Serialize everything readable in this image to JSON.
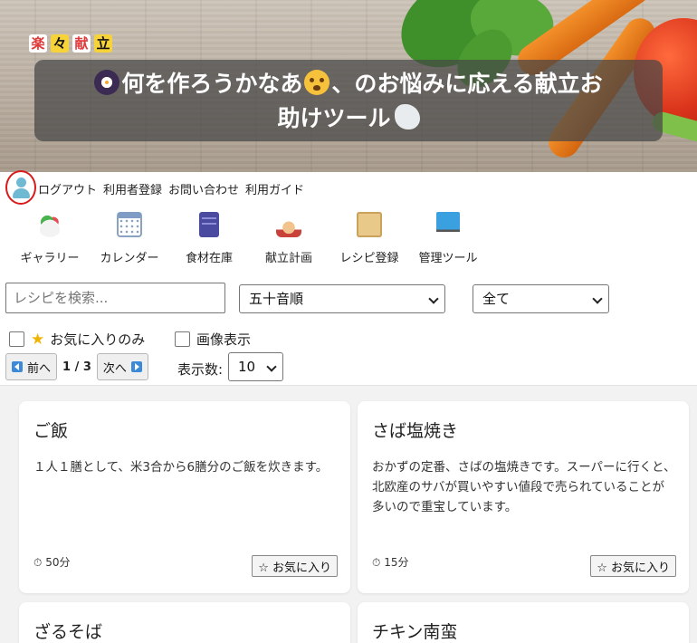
{
  "brand": {
    "chars": [
      "楽",
      "々",
      "献",
      "立"
    ]
  },
  "header": {
    "tagline_part1": "何を作ろうかなあ",
    "tagline_part2": "、のお悩みに応える献立お",
    "tagline_part3": "助けツール"
  },
  "top_links": [
    "ログアウト",
    "利用者登録",
    "お問い合わせ",
    "利用ガイド"
  ],
  "nav": [
    {
      "label": "ギャラリー",
      "icon": "salad-icon"
    },
    {
      "label": "カレンダー",
      "icon": "calendar-icon"
    },
    {
      "label": "食材在庫",
      "icon": "cabinet-icon"
    },
    {
      "label": "献立計画",
      "icon": "chef-icon"
    },
    {
      "label": "レシピ登録",
      "icon": "scroll-icon"
    },
    {
      "label": "管理ツール",
      "icon": "computer-icon"
    }
  ],
  "search": {
    "placeholder": "レシピを検索..."
  },
  "sort_select": {
    "value": "五十音順"
  },
  "category_select": {
    "value": "全て"
  },
  "filters": {
    "favorites_only": "お気に入りのみ",
    "show_images": "画像表示"
  },
  "pager": {
    "prev": "前へ",
    "page": "1 / 3",
    "next": "次へ",
    "per_page_label": "表示数:",
    "per_page_value": "10"
  },
  "recipes": [
    {
      "title": "ご飯",
      "description": "１人１膳として、米3合から6膳分のご飯を炊きます。",
      "time": "50分",
      "fav_label": "☆ お気に入り"
    },
    {
      "title": "さば塩焼き",
      "description": "おかずの定番、さばの塩焼きです。スーパーに行くと、北欧産のサバが買いやすい値段で売られていることが多いので重宝しています。",
      "time": "15分",
      "fav_label": "☆ お気に入り"
    },
    {
      "title": "ざるそば"
    },
    {
      "title": "チキン南蛮"
    }
  ]
}
